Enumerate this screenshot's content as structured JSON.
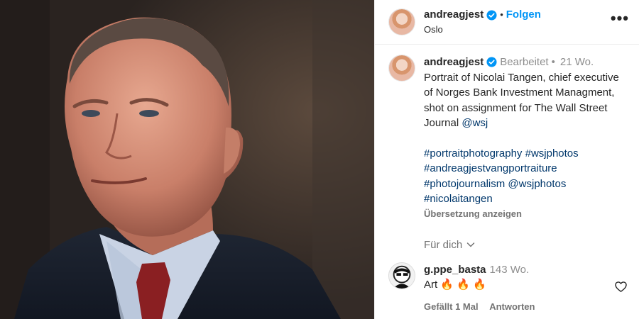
{
  "colors": {
    "accent": "#0095f6",
    "link": "#00376b",
    "muted": "#8e8e8e"
  },
  "header": {
    "username": "andreagjest",
    "separator": "•",
    "follow_label": "Folgen",
    "location": "Oslo",
    "more_icon": "more-horizontal-icon",
    "more_label": "•••"
  },
  "caption": {
    "username": "andreagjest",
    "edited_label": "Bearbeitet",
    "separator": "•",
    "time": "21 Wo.",
    "text": "Portrait of Nicolai Tangen, chief executive of Norges Bank Investment Managment, shot on assignment for The Wall Street Journal",
    "mention": "@wsj",
    "hashtags": [
      "#portraitphotography",
      "#wsjphotos",
      "#andreagjestvangportraiture",
      "#photojournalism",
      "@wsjphotos",
      "#nicolaitangen"
    ],
    "translate_label": "Übersetzung anzeigen",
    "for_you_label": "Für dich"
  },
  "comment": {
    "username": "g.ppe_basta",
    "time": "143 Wo.",
    "text": "Art 🔥 🔥 🔥",
    "likes_label": "Gefällt 1 Mal",
    "reply_label": "Antworten"
  }
}
